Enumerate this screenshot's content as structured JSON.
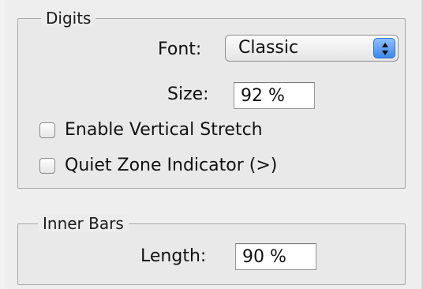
{
  "digits": {
    "title": "Digits",
    "font_label": "Font:",
    "font_value": "Classic",
    "size_label": "Size:",
    "size_value": "92 %",
    "vertical_stretch_label": "Enable Vertical Stretch",
    "quiet_zone_label": "Quiet Zone Indicator (>)"
  },
  "inner_bars": {
    "title": "Inner Bars",
    "length_label": "Length:",
    "length_value": "90 %"
  }
}
